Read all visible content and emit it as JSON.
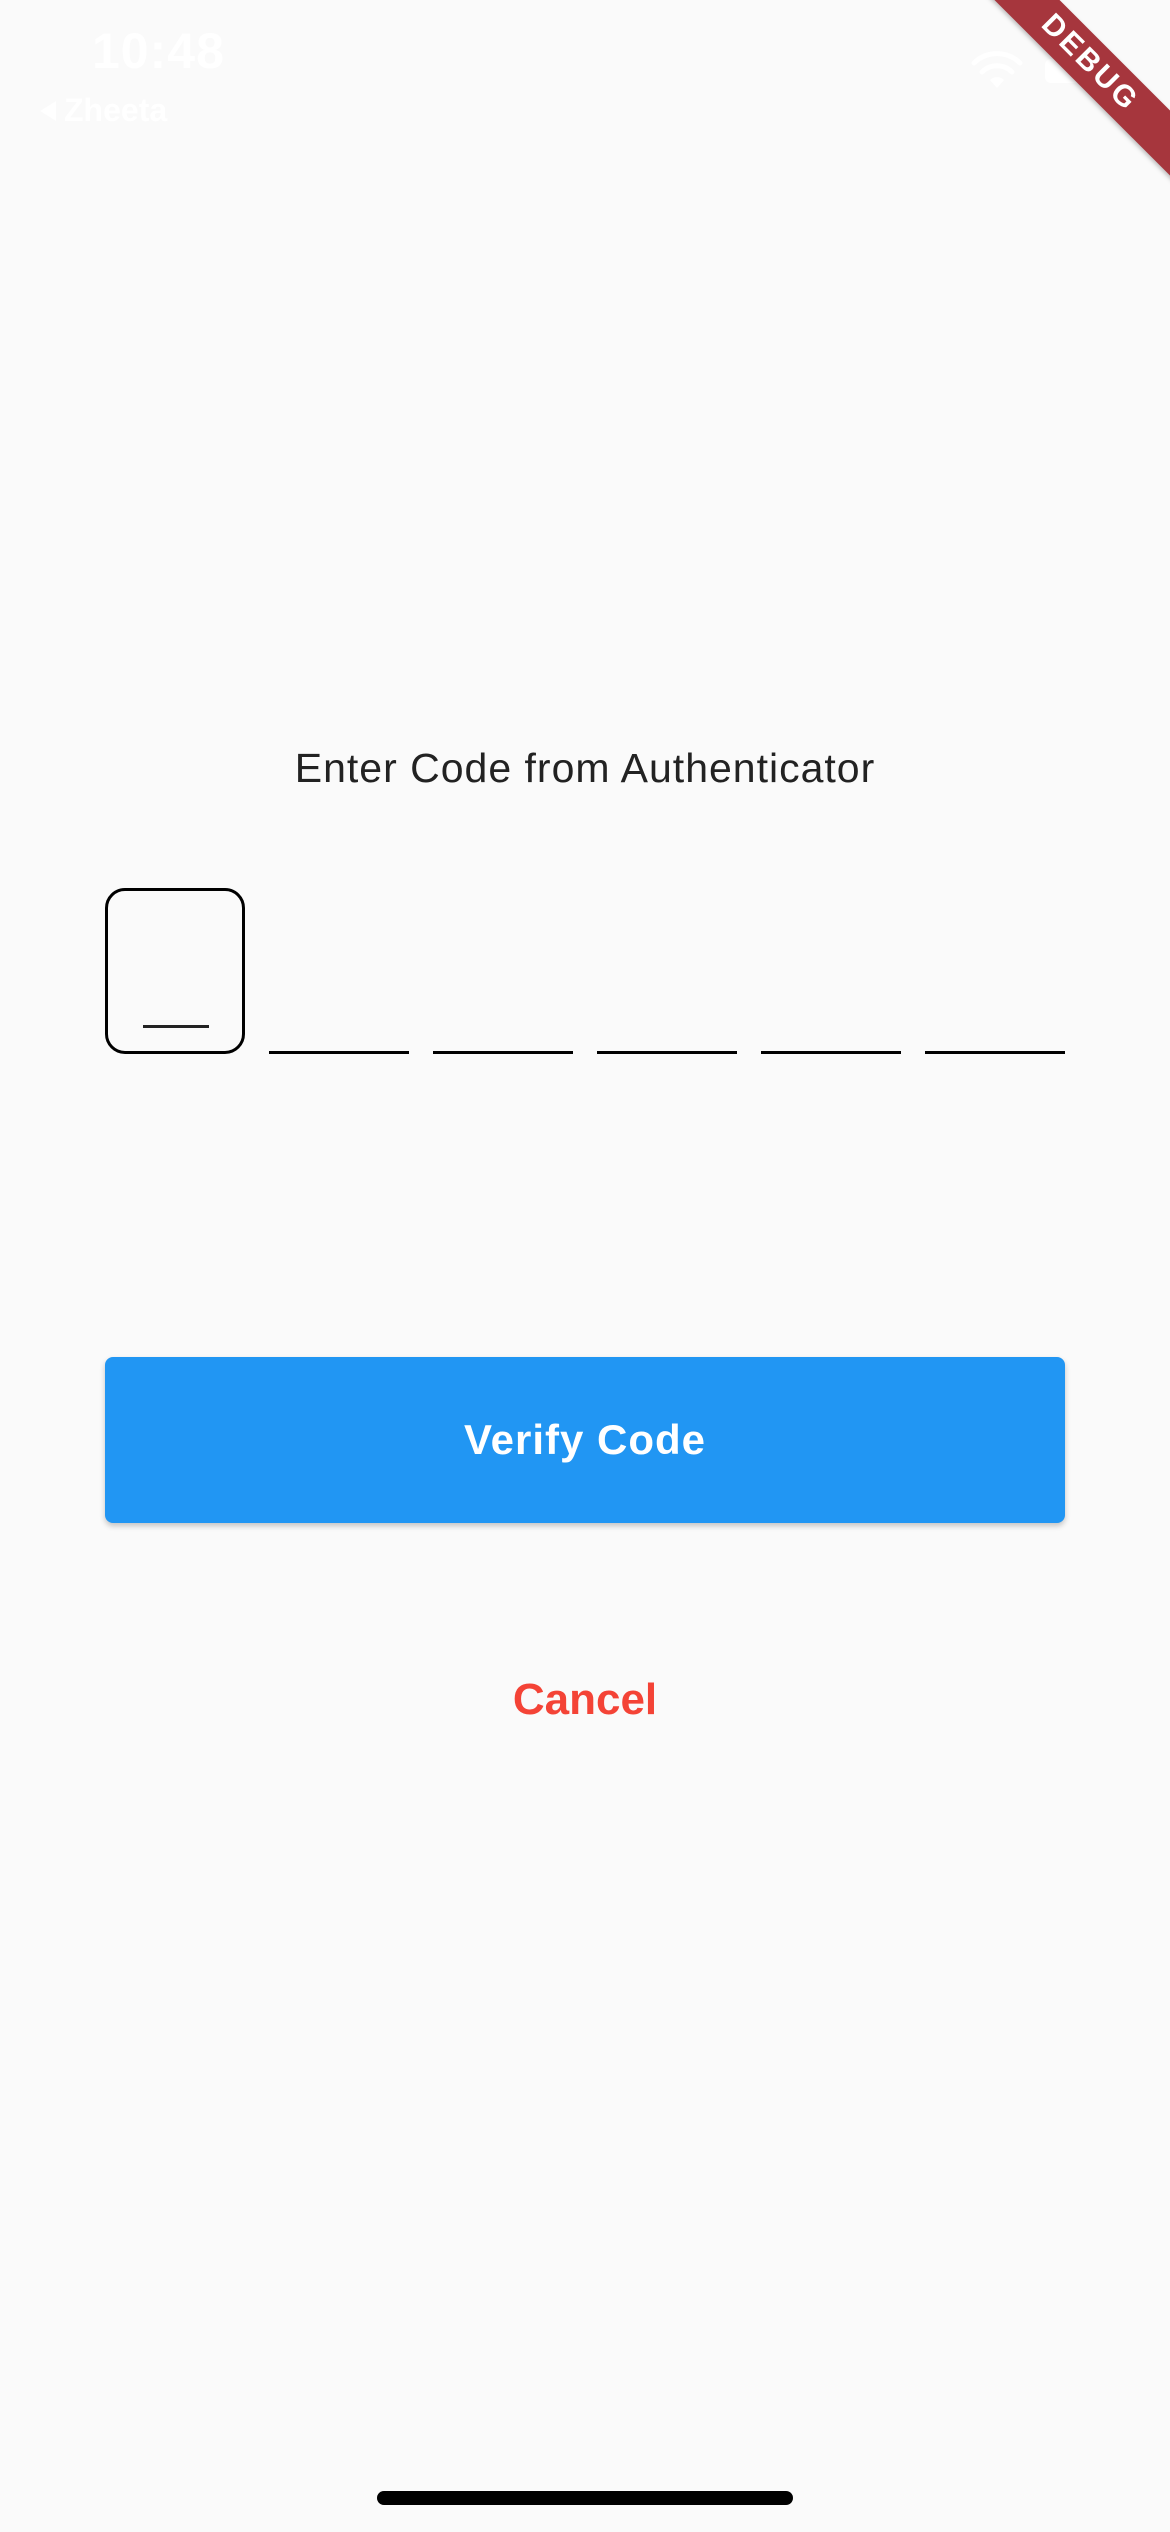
{
  "status_bar": {
    "time": "10:48",
    "back_app": "Zheeta"
  },
  "debug_banner": "DEBUG",
  "verification": {
    "prompt": "Enter Code from Authenticator",
    "code_digits": [
      "",
      "",
      "",
      "",
      "",
      ""
    ],
    "focused_index": 0
  },
  "actions": {
    "verify_label": "Verify Code",
    "cancel_label": "Cancel"
  },
  "colors": {
    "background": "#fafafa",
    "primary": "#2196f3",
    "cancel": "#f44336",
    "debug_ribbon": "#a6363d"
  },
  "icons": {
    "back": "back-arrow-icon",
    "wifi": "wifi-icon",
    "battery": "battery-icon"
  }
}
